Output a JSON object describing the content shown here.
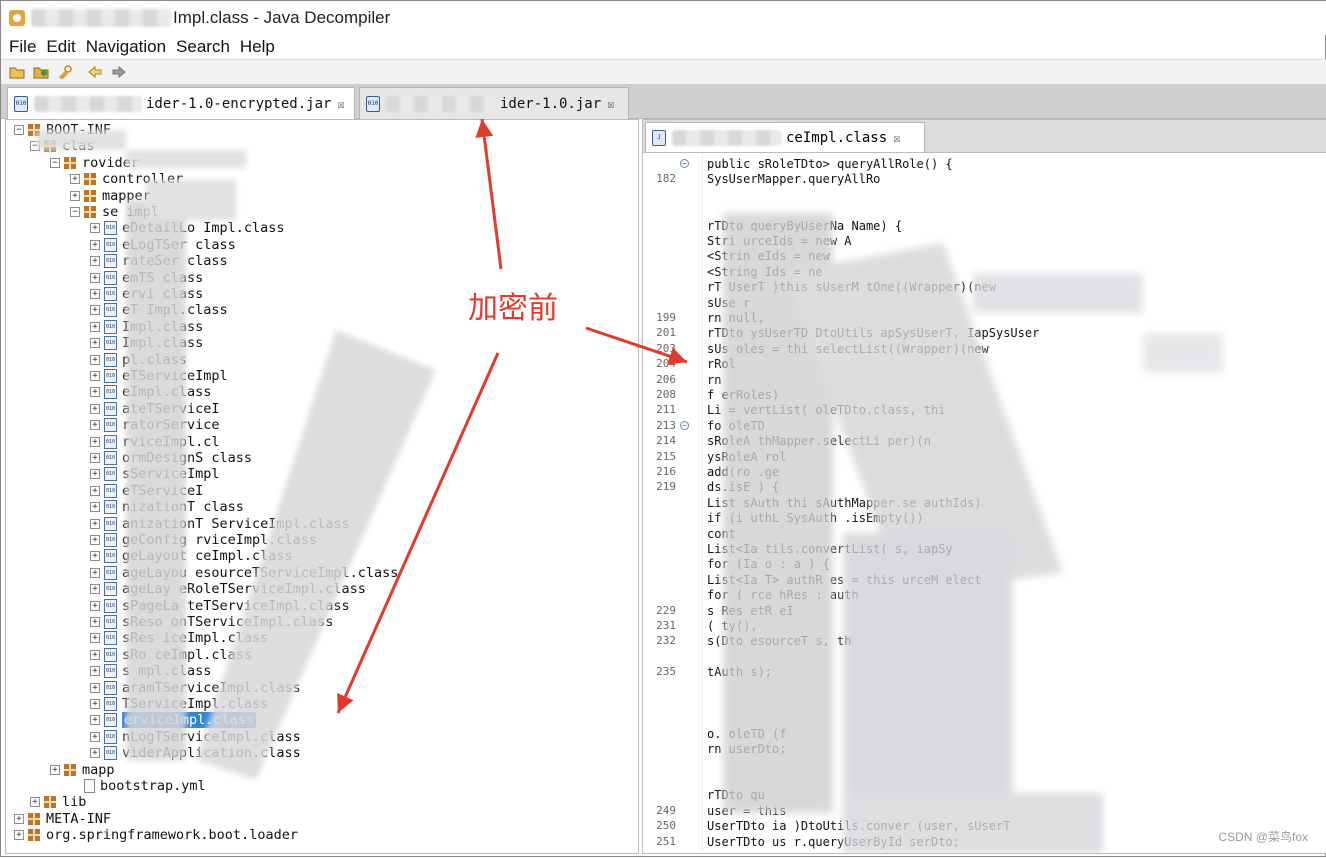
{
  "window": {
    "title": "Impl.class - Java Decompiler"
  },
  "menu": [
    "File",
    "Edit",
    "Navigation",
    "Search",
    "Help"
  ],
  "toolbar_icons": [
    "open-folder-icon",
    "open-type-icon",
    "search-icon",
    "back-arrow-icon",
    "forward-arrow-icon"
  ],
  "jar_tabs": [
    {
      "label": "ider-1.0-encrypted.jar",
      "close": "☒",
      "active": true
    },
    {
      "label": "ider-1.0.jar",
      "close": "☒",
      "active": false
    }
  ],
  "tree": [
    {
      "label": "BOOT-INF",
      "icon": "package",
      "exp": "⊟"
    },
    {
      "label": "clas",
      "icon": "package",
      "exp": "⊟"
    },
    {
      "label": "rovider",
      "icon": "package",
      "exp": "⊟"
    },
    {
      "label": "controller",
      "icon": "package",
      "exp": "⊞"
    },
    {
      "label": "mapper",
      "icon": "package",
      "exp": "⊞"
    },
    {
      "label": "se impl",
      "icon": "package",
      "exp": "⊟"
    },
    {
      "label": "eDetailLo Impl.class",
      "icon": "class",
      "exp": "⊞"
    },
    {
      "label": "eLogTSer class",
      "icon": "class",
      "exp": "⊞"
    },
    {
      "label": "rateSer class",
      "icon": "class",
      "exp": "⊞"
    },
    {
      "label": "emTS class",
      "icon": "class",
      "exp": "⊞"
    },
    {
      "label": "ervi class",
      "icon": "class",
      "exp": "⊞"
    },
    {
      "label": "eT Impl.class",
      "icon": "class",
      "exp": "⊞"
    },
    {
      "label": "Impl.class",
      "icon": "class",
      "exp": "⊞"
    },
    {
      "label": "Impl.class",
      "icon": "class",
      "exp": "⊞"
    },
    {
      "label": "pl.class",
      "icon": "class",
      "exp": "⊞"
    },
    {
      "label": "eTServiceImpl",
      "icon": "class",
      "exp": "⊞"
    },
    {
      "label": "eImpl.class",
      "icon": "class",
      "exp": "⊞"
    },
    {
      "label": "ateTServiceI",
      "icon": "class",
      "exp": "⊞"
    },
    {
      "label": "ratorService",
      "icon": "class",
      "exp": "⊞"
    },
    {
      "label": "rviceImpl.cl",
      "icon": "class",
      "exp": "⊞"
    },
    {
      "label": "ormDesignS class",
      "icon": "class",
      "exp": "⊞"
    },
    {
      "label": "sServiceImpl",
      "icon": "class",
      "exp": "⊞"
    },
    {
      "label": "eTServiceI",
      "icon": "class",
      "exp": "⊞"
    },
    {
      "label": "nizationT class",
      "icon": "class",
      "exp": "⊞"
    },
    {
      "label": "anizationT ServiceImpl.class",
      "icon": "class",
      "exp": "⊞"
    },
    {
      "label": "geConfig rviceImpl.class",
      "icon": "class",
      "exp": "⊞"
    },
    {
      "label": "geLayout ceImpl.class",
      "icon": "class",
      "exp": "⊞"
    },
    {
      "label": "ageLayou esourceTServiceImpl.class",
      "icon": "class",
      "exp": "⊞"
    },
    {
      "label": "ageLay eRoleTServiceImpl.class",
      "icon": "class",
      "exp": "⊞"
    },
    {
      "label": "sPageLa teTServiceImpl.class",
      "icon": "class",
      "exp": "⊞"
    },
    {
      "label": "sReso onTServiceImpl.class",
      "icon": "class",
      "exp": "⊞"
    },
    {
      "label": "sRes iceImpl.class",
      "icon": "class",
      "exp": "⊞"
    },
    {
      "label": "sRo ceImpl.class",
      "icon": "class",
      "exp": "⊞"
    },
    {
      "label": "s mpl.class",
      "icon": "class",
      "exp": "⊞"
    },
    {
      "label": "aramTServiceImpl.class",
      "icon": "class",
      "exp": "⊞"
    },
    {
      "label": "TServiceImpl.class",
      "icon": "class",
      "exp": "⊞"
    },
    {
      "label": "erviceImpl.class",
      "icon": "class",
      "exp": "⊞",
      "selected": true
    },
    {
      "label": "nLogTServiceImpl.class",
      "icon": "class",
      "exp": "⊞"
    },
    {
      "label": "viderApplication.class",
      "icon": "class",
      "exp": "⊞"
    },
    {
      "label": "mapp",
      "icon": "package",
      "exp": "⊞"
    },
    {
      "label": "bootstrap.yml",
      "icon": "yml",
      "exp": ""
    },
    {
      "label": "lib",
      "icon": "package",
      "exp": "⊞"
    },
    {
      "label": "META-INF",
      "icon": "package",
      "exp": "⊞"
    },
    {
      "label": "org.springframework.boot.loader",
      "icon": "package",
      "exp": "⊞"
    }
  ],
  "code_tab": {
    "label": "ceImpl.class",
    "close": "☒"
  },
  "code_lines": [
    {
      "num": "",
      "text": "public        sRoleTDto> queryAllRole() {",
      "fold": true
    },
    {
      "num": "182",
      "text": "          SysUserMapper.queryAllRo"
    },
    {
      "num": "",
      "text": ""
    },
    {
      "num": "",
      "text": ""
    },
    {
      "num": "",
      "text": "       rTDto queryByUserNa              Name) {"
    },
    {
      "num": "",
      "text": "    Stri    urceIds = new A"
    },
    {
      "num": "",
      "text": "   <Strin   eIds = new "
    },
    {
      "num": "",
      "text": "   <String    Ids = ne"
    },
    {
      "num": "",
      "text": "     rT    UserT        )this     sUserM        tOne((Wrapper)(new"
    },
    {
      "num": "",
      "text": "     sUse   r"
    },
    {
      "num": "199",
      "text": "   rn null,"
    },
    {
      "num": "201",
      "text": "     rTDto      ysUserTD    DtoUtils        apSysUserT, IapSysUser"
    },
    {
      "num": "203",
      "text": "     sUs        oles = thi                 selectList((Wrapper)(new"
    },
    {
      "num": "204",
      "text": "   rRol"
    },
    {
      "num": "206",
      "text": "    rn"
    },
    {
      "num": "208",
      "text": "  f                      erRoles)"
    },
    {
      "num": "211",
      "text": "  Li                 =          vertList(     oleTDto.class, thi"
    },
    {
      "num": "213",
      "text": "  fo        oleTD",
      "fold": true
    },
    {
      "num": "214",
      "text": "       sRoleA           thMapper.selectLi      per)(n"
    },
    {
      "num": "215",
      "text": "      ysRoleA   rol"
    },
    {
      "num": "216",
      "text": "        add(ro     .ge"
    },
    {
      "num": "219",
      "text": "        ds.isE     ) {"
    },
    {
      "num": "",
      "text": "    List  sAuth        thi      sAuthMapper.se        authIds)"
    },
    {
      "num": "",
      "text": "    if (i   uthL          SysAuth .isEmpty())"
    },
    {
      "num": "",
      "text": "      cont"
    },
    {
      "num": "",
      "text": "    List<Ia          tils.convertList(           s, iapSy"
    },
    {
      "num": "",
      "text": "    for (Ia           o : a      ) {"
    },
    {
      "num": "",
      "text": "      List<Ia     T> authR   es = this        urceM     elect"
    },
    {
      "num": "",
      "text": "      for (     rce    hRes     : auth"
    },
    {
      "num": "229",
      "text": "        s          Res     etR   eI"
    },
    {
      "num": "231",
      "text": "      (      ty(),"
    },
    {
      "num": "232",
      "text": "           s(Dto              esourceT          s, th"
    },
    {
      "num": "",
      "text": ""
    },
    {
      "num": "235",
      "text": "       tAuth      s);"
    },
    {
      "num": "",
      "text": ""
    },
    {
      "num": "",
      "text": ""
    },
    {
      "num": "",
      "text": ""
    },
    {
      "num": "",
      "text": "    o.     oleTD       (f"
    },
    {
      "num": "",
      "text": "   rn userDto;"
    },
    {
      "num": "",
      "text": ""
    },
    {
      "num": "",
      "text": ""
    },
    {
      "num": "",
      "text": "       rTDto qu"
    },
    {
      "num": "249",
      "text": "      user = this"
    },
    {
      "num": "250",
      "text": "    UserTDto ia                 )DtoUtils.conver    (user,      sUserT"
    },
    {
      "num": "251",
      "text": "    UserTDto us                 r.queryUserById      serDto;"
    }
  ],
  "annotation": {
    "text": "加密前",
    "color": "#e03b2b"
  },
  "watermark": "CSDN @菜鸟fox"
}
